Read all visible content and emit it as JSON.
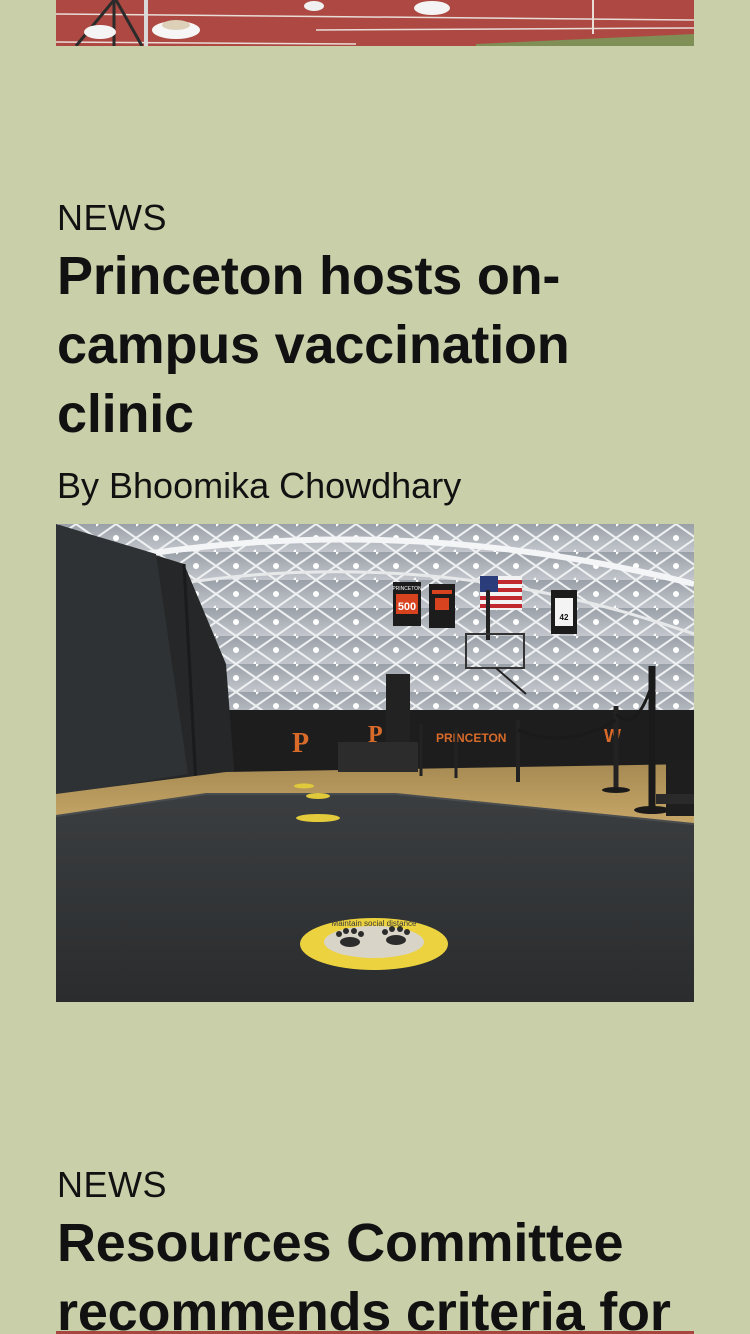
{
  "previous_story": {
    "image_alt": "Athletes' feet on a red running track"
  },
  "articles": [
    {
      "kicker": "NEWS",
      "headline_lines": [
        "Princeton hosts on-",
        "campus vaccination",
        "clinic"
      ],
      "byline": "By Bhoomika Chowdhary",
      "photo_alt": "Gymnasium set up as a vaccination clinic with social distancing floor markers",
      "photo_text": {
        "floor_marker": "Maintain social distance",
        "banner_1_top": "PRINCETON",
        "banner_1_number": "500",
        "banner_2_top": "",
        "banner_jersey_number": "42",
        "wall_sign": "PRINCETON"
      }
    },
    {
      "kicker": "NEWS",
      "headline_lines": [
        "Resources Committee",
        "recommends criteria for"
      ]
    }
  ],
  "colors": {
    "background": "#c9cfa9",
    "text": "#111111",
    "track_red": "#a8453f"
  }
}
